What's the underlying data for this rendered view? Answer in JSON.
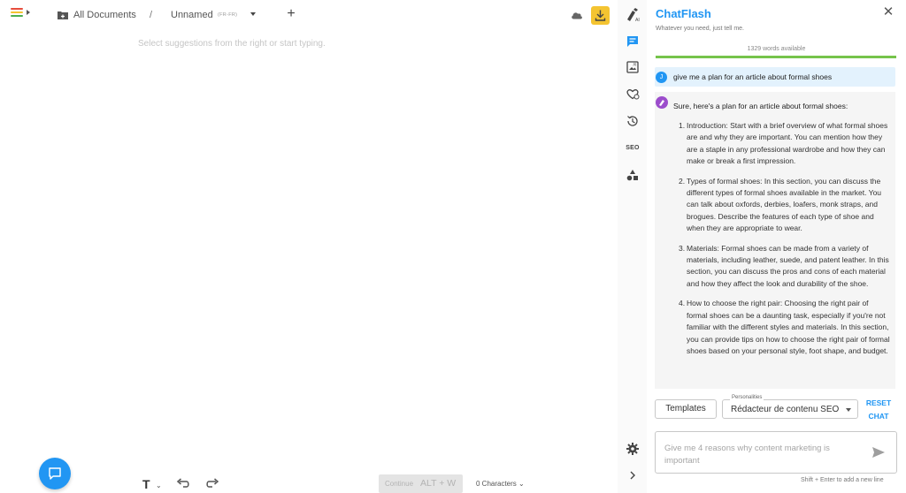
{
  "app": {
    "breadcrumb": {
      "root": "All Documents",
      "separator": "/",
      "document": "Unnamed",
      "language": "(FR-FR)"
    },
    "editor": {
      "placeholder": "Select suggestions from the right or start typing."
    },
    "toolbar": {
      "text_style": "T",
      "continue_label": "Continue",
      "continue_shortcut": "ALT + W",
      "char_count": "0 Characters"
    },
    "colors": {
      "accent": "#2196f3",
      "download": "#f4c431",
      "progress": "#76c44b",
      "user_bubble": "#e3f2fd"
    }
  },
  "rail": {
    "icons": [
      "ai-pen-icon",
      "chat-icon",
      "image-ai-icon",
      "heart-ai-icon",
      "history-icon",
      "seo-icon",
      "shapes-icon",
      "settings-icon",
      "chevron-right-icon"
    ],
    "seo_label": "SEO"
  },
  "chat": {
    "title": "ChatFlash",
    "subtitle": "Whatever you need, just tell me.",
    "words_available": "1329 words available",
    "words_fraction": 1.0,
    "user_message": {
      "avatar": "J",
      "text": "give me a plan for an article about formal shoes"
    },
    "bot_message": {
      "intro": "Sure, here's a plan for an article about formal shoes:",
      "items": [
        {
          "n": "1.",
          "text": "Introduction: Start with a brief overview of what formal shoes are and why they are important. You can mention how they are a staple in any professional wardrobe and how they can make or break a first impression."
        },
        {
          "n": "2.",
          "text": "Types of formal shoes: In this section, you can discuss the different types of formal shoes available in the market. You can talk about oxfords, derbies, loafers, monk straps, and brogues. Describe the features of each type of shoe and when they are appropriate to wear."
        },
        {
          "n": "3.",
          "text": "Materials: Formal shoes can be made from a variety of materials, including leather, suede, and patent leather. In this section, you can discuss the pros and cons of each material and how they affect the look and durability of the shoe."
        },
        {
          "n": "4.",
          "text": "How to choose the right pair: Choosing the right pair of formal shoes can be a daunting task, especially if you're not familiar with the different styles and materials. In this section, you can provide tips on how to choose the right pair of formal shoes based on your personal style, foot shape, and budget."
        }
      ]
    },
    "templates_label": "Templates",
    "personalities_label": "Personalities",
    "personality_value": "Rédacteur de contenu SEO",
    "reset_label_1": "RESET",
    "reset_label_2": "CHAT",
    "input_placeholder": "Give me 4 reasons why content marketing is important",
    "hint": "Shift + Enter to add a new line"
  }
}
